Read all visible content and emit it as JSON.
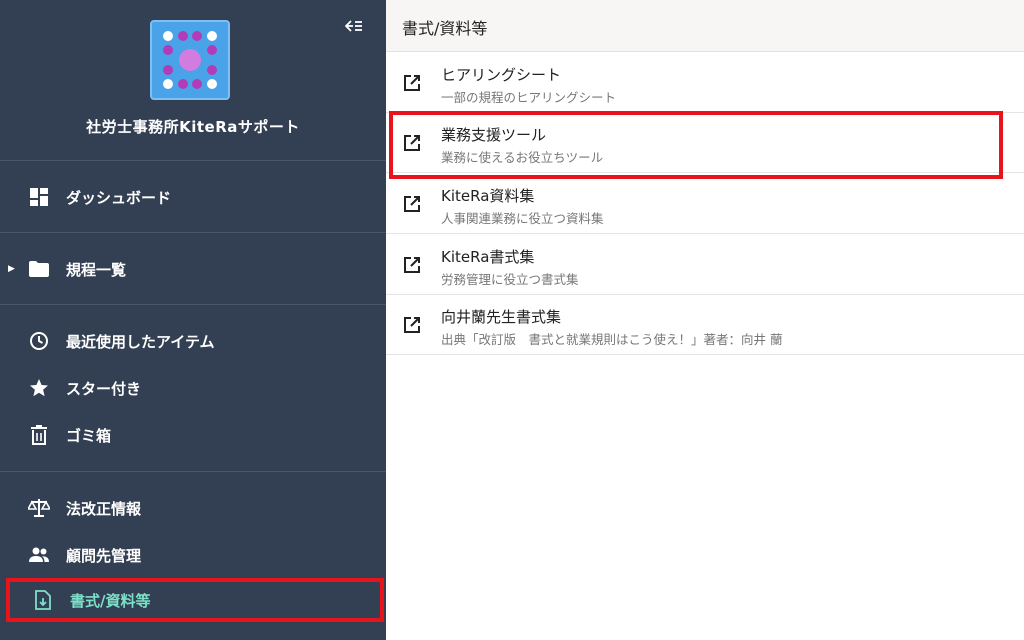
{
  "sidebar": {
    "org_name": "社労士事務所KiteRaサポート",
    "items": [
      {
        "label": "ダッシュボード",
        "icon": "dashboard-icon"
      },
      {
        "label": "規程一覧",
        "icon": "folder-icon"
      },
      {
        "label": "最近使用したアイテム",
        "icon": "clock-icon"
      },
      {
        "label": "スター付き",
        "icon": "star-icon"
      },
      {
        "label": "ゴミ箱",
        "icon": "trash-icon"
      },
      {
        "label": "法改正情報",
        "icon": "scale-icon"
      },
      {
        "label": "顧問先管理",
        "icon": "people-icon"
      },
      {
        "label": "書式/資料等",
        "icon": "file-download-icon"
      }
    ],
    "active_color": "#7de0c8"
  },
  "panel": {
    "title": "書式/資料等",
    "items": [
      {
        "title": "ヒアリングシート",
        "sub": "一部の規程のヒアリングシート"
      },
      {
        "title": "業務支援ツール",
        "sub": "業務に使えるお役立ちツール"
      },
      {
        "title": "KiteRa資料集",
        "sub": "人事関連業務に役立つ資料集"
      },
      {
        "title": "KiteRa書式集",
        "sub": "労務管理に役立つ書式集"
      },
      {
        "title": "向井蘭先生書式集",
        "sub": "出典「改訂版　書式と就業規則はこう使え！」著者：向井 蘭"
      }
    ]
  },
  "colors": {
    "sidebar_bg": "#333f52",
    "highlight": "#e8141b"
  }
}
